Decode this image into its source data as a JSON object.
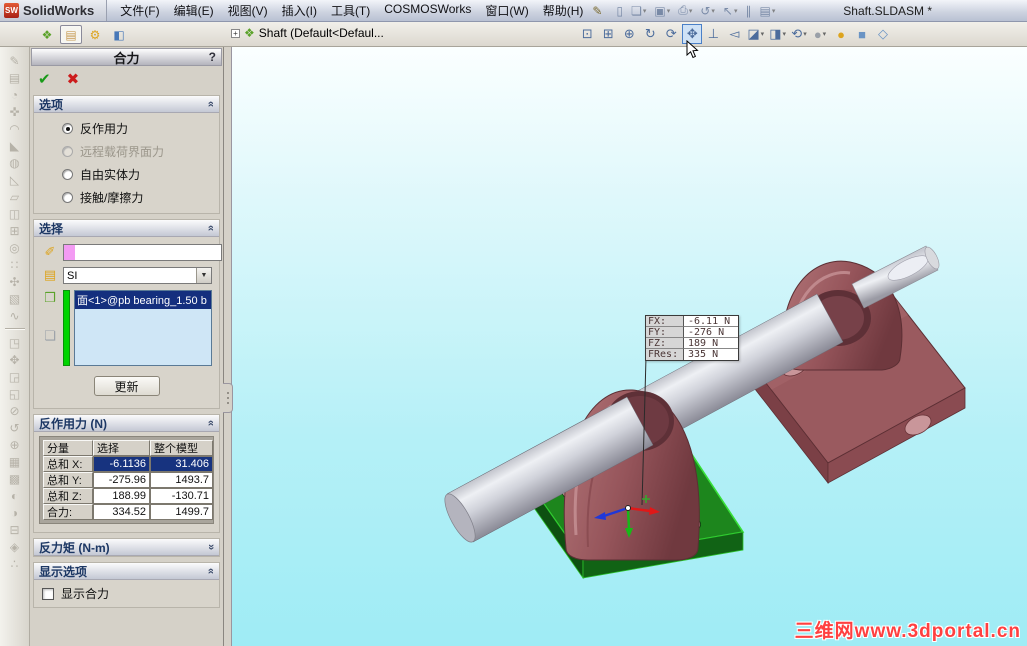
{
  "window": {
    "logo_badge": "SW",
    "logo_text": "SolidWorks",
    "document": "Shaft.SLDASM *"
  },
  "menubar": {
    "items": [
      "文件(F)",
      "编辑(E)",
      "视图(V)",
      "插入(I)",
      "工具(T)",
      "COSMOSWorks",
      "窗口(W)",
      "帮助(H)"
    ],
    "trailing_glyph": "✎"
  },
  "standard_toolbar": {
    "icons": [
      {
        "name": "new-document-icon",
        "glyph": "▯"
      },
      {
        "name": "open-icon",
        "glyph": "❏",
        "dd": true
      },
      {
        "name": "save-icon",
        "glyph": "▣",
        "dd": true
      },
      {
        "name": "print-icon",
        "glyph": "⎙",
        "dd": true
      },
      {
        "name": "undo-icon",
        "glyph": "↺",
        "dd": true
      },
      {
        "name": "select-icon",
        "glyph": "↖",
        "dd": true
      },
      {
        "name": "attachment-icon",
        "glyph": "∥"
      },
      {
        "name": "options-icon",
        "glyph": "▤",
        "dd": true
      }
    ]
  },
  "panel_tabs": [
    {
      "name": "tab-featuremanager",
      "glyph": "❖",
      "cls": "c-green"
    },
    {
      "name": "tab-propertymanager",
      "glyph": "▤",
      "cls": "c-tan",
      "active": true
    },
    {
      "name": "tab-configurationmanager",
      "glyph": "⚙",
      "cls": "c-gold"
    },
    {
      "name": "tab-dimxpert",
      "glyph": "◧",
      "cls": "c-multi"
    }
  ],
  "feature_tree": {
    "expander": "+",
    "icon_glyph": "❖",
    "label": "Shaft  (Default<Defaul..."
  },
  "view_toolbar": {
    "icons": [
      {
        "name": "zoom-fit-icon",
        "glyph": "⊡"
      },
      {
        "name": "zoom-area-icon",
        "glyph": "⊞"
      },
      {
        "name": "zoom-in-out-icon",
        "glyph": "⊕"
      },
      {
        "name": "rotate-view-icon",
        "glyph": "↻"
      },
      {
        "name": "roll-view-icon",
        "glyph": "⟳"
      },
      {
        "name": "pan-icon",
        "glyph": "✥",
        "active": true
      },
      {
        "name": "normal-to-icon",
        "glyph": "⊥"
      },
      {
        "name": "previous-view-icon",
        "glyph": "◅"
      },
      {
        "name": "section-view-icon",
        "glyph": "◪",
        "dd": true
      },
      {
        "name": "display-style-icon",
        "glyph": "◨",
        "dd": true
      },
      {
        "name": "view-orientation-icon",
        "glyph": "⟲",
        "dd": true
      },
      {
        "name": "appearance-icon",
        "glyph": "●",
        "cls": "c-gray",
        "dd": true
      },
      {
        "name": "shaded-icon",
        "glyph": "●",
        "cls": "c-gold"
      },
      {
        "name": "shadows-icon",
        "glyph": "■",
        "cls": "c-blue"
      },
      {
        "name": "perspective-icon",
        "glyph": "◇",
        "cls": "c-blue"
      }
    ]
  },
  "left_toolbar": {
    "top": [
      {
        "name": "sketch-icon",
        "glyph": "✎"
      },
      {
        "name": "extrude-icon",
        "glyph": "▤"
      },
      {
        "name": "revolve-icon",
        "glyph": "◔"
      },
      {
        "name": "move-icon",
        "glyph": "✜"
      },
      {
        "name": "fillet-icon",
        "glyph": "◠"
      },
      {
        "name": "chamfer-icon",
        "glyph": "◣"
      },
      {
        "name": "shell-icon",
        "glyph": "◍"
      },
      {
        "name": "draft-icon",
        "glyph": "◺"
      },
      {
        "name": "rib-icon",
        "glyph": "▱"
      },
      {
        "name": "mirror-icon",
        "glyph": "◫"
      },
      {
        "name": "pattern-icon",
        "glyph": "⊞"
      },
      {
        "name": "hole-icon",
        "glyph": "◎"
      },
      {
        "name": "dots-icon",
        "glyph": "∷"
      },
      {
        "name": "gear-icon",
        "glyph": "✣"
      },
      {
        "name": "surface-icon",
        "glyph": "▧"
      },
      {
        "name": "curve-icon",
        "glyph": "∿"
      }
    ],
    "bottom": [
      {
        "name": "insert-component-icon",
        "glyph": "◳"
      },
      {
        "name": "mate-icon",
        "glyph": "✥",
        "cls": "c-gold"
      },
      {
        "name": "hide-component-icon",
        "glyph": "◲"
      },
      {
        "name": "edit-component-icon",
        "glyph": "◱"
      },
      {
        "name": "no-external-ref-icon",
        "glyph": "⊘"
      },
      {
        "name": "rotate-component-icon",
        "glyph": "↺"
      },
      {
        "name": "smart-fastener-icon",
        "glyph": "⊕"
      },
      {
        "name": "exploded-view-icon",
        "glyph": "▦"
      },
      {
        "name": "explode-line-icon",
        "glyph": "▩"
      },
      {
        "name": "interference-icon",
        "glyph": "◐"
      },
      {
        "name": "clearance-icon",
        "glyph": "◑"
      },
      {
        "name": "assembly-feature-icon",
        "glyph": "⊟"
      },
      {
        "name": "belt-chain-icon",
        "glyph": "◈"
      },
      {
        "name": "simulation-icon",
        "glyph": "∴"
      }
    ]
  },
  "panel": {
    "title": "合力",
    "help_label": "?",
    "ok_glyph": "✔",
    "cancel_glyph": "✖",
    "options": {
      "label": "选项",
      "radios": [
        {
          "label": "反作用力",
          "selected": true
        },
        {
          "label": "远程载荷界面力",
          "disabled": true
        },
        {
          "label": "自由实体力"
        },
        {
          "label": "接触/摩擦力"
        }
      ]
    },
    "selection": {
      "label": "选择",
      "entity_icon_glyph": "✐",
      "units_icon_glyph": "▤",
      "solid_icon_glyph": "❒",
      "faces_icon_glyph": "❏",
      "entity_value": "",
      "units_value": "SI",
      "items": [
        {
          "text": "面<1>@pb bearing_1.50 b",
          "selected": true
        }
      ],
      "update_label": "更新"
    },
    "reaction": {
      "label": "反作用力 (N)",
      "headers": [
        "分量",
        "选择",
        "整个模型"
      ],
      "rows": [
        {
          "label": "总和 X:",
          "sel": "-6.1136",
          "whole": "31.406",
          "hl": true
        },
        {
          "label": "总和 Y:",
          "sel": "-275.96",
          "whole": "1493.7"
        },
        {
          "label": "总和 Z:",
          "sel": "188.99",
          "whole": "-130.71"
        },
        {
          "label": "合力:",
          "sel": "334.52",
          "whole": "1499.7"
        }
      ]
    },
    "moment": {
      "label": "反力矩 (N-m)"
    },
    "display": {
      "label": "显示选项",
      "checkbox_label": "显示合力",
      "checked": false
    }
  },
  "viewport": {
    "callout_rows": [
      {
        "label": "FX:",
        "value": "-6.11 N"
      },
      {
        "label": "FY:",
        "value": "-276 N"
      },
      {
        "label": "FZ:",
        "value": "189 N"
      },
      {
        "label": "FRes:",
        "value": "335 N"
      }
    ],
    "watermark": "三维网www.3dportal.cn"
  },
  "colors": {
    "selection_highlight": "#17337f",
    "viewport_top": "#fbffff",
    "viewport_bottom": "#9fecf5",
    "bearing_maroon": "#9a5a5f",
    "selected_face_green": "#1d861d",
    "shaft_gray": "#c8cad2",
    "selection_list_green_bar": "#00d400",
    "entity_swatch_pink": "#f39bf3",
    "watermark_red": "#ff4040",
    "triad_x_red": "#e01818",
    "triad_y_green": "#18b818",
    "triad_z_blue": "#2038d8"
  }
}
